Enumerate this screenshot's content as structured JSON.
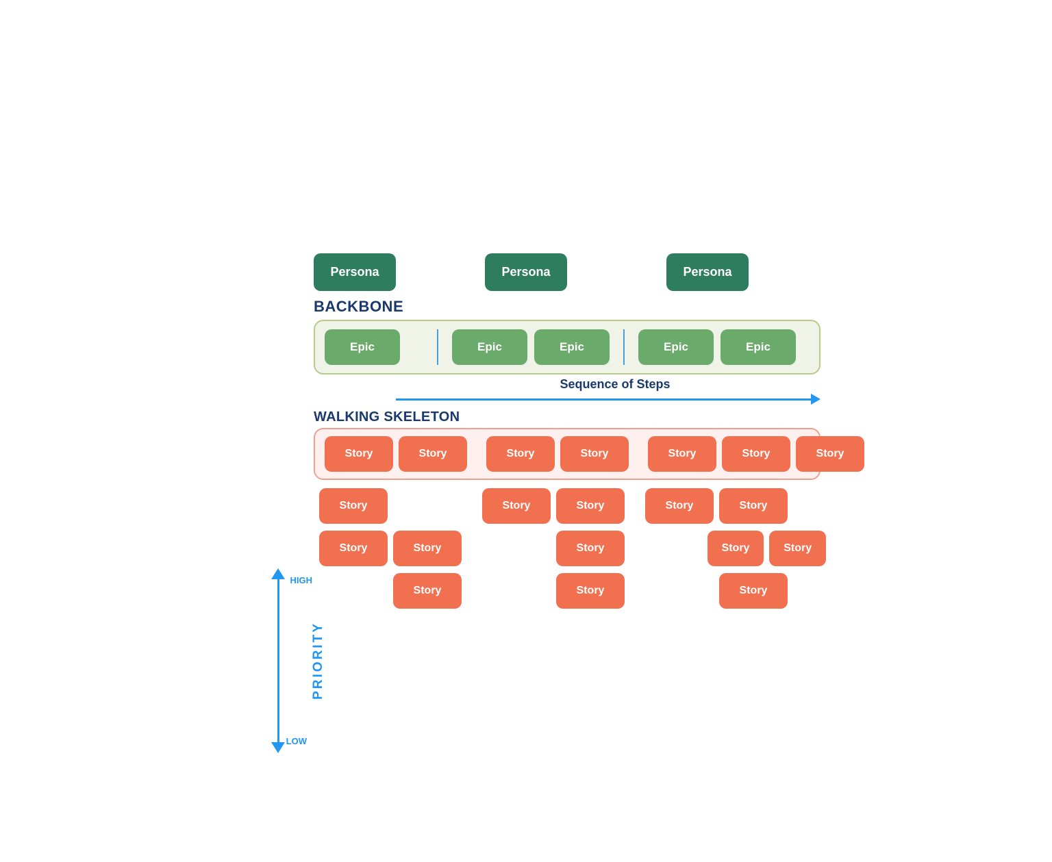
{
  "personas": [
    {
      "label": "Persona"
    },
    {
      "label": "Persona"
    },
    {
      "label": "Persona"
    }
  ],
  "backbone_label": "BACKBONE",
  "epics": [
    {
      "label": "Epic"
    },
    {
      "label": "Epic"
    },
    {
      "label": "Epic"
    },
    {
      "label": "Epic"
    },
    {
      "label": "Epic"
    }
  ],
  "sequence_label": "Sequence of Steps",
  "walking_skeleton_label": "WALKING SKELETON",
  "priority_label": "PRIORITY",
  "high_label": "HIGH",
  "low_label": "LOW",
  "story_label": "Story",
  "colors": {
    "persona_bg": "#2e7d5e",
    "epic_bg": "#6aaa6a",
    "story_bg": "#f07050",
    "backbone_band": "#f0f4e8",
    "skeleton_band": "#fdf0ee",
    "arrow_blue": "#2196f3",
    "dark_blue": "#1a3a6e"
  }
}
